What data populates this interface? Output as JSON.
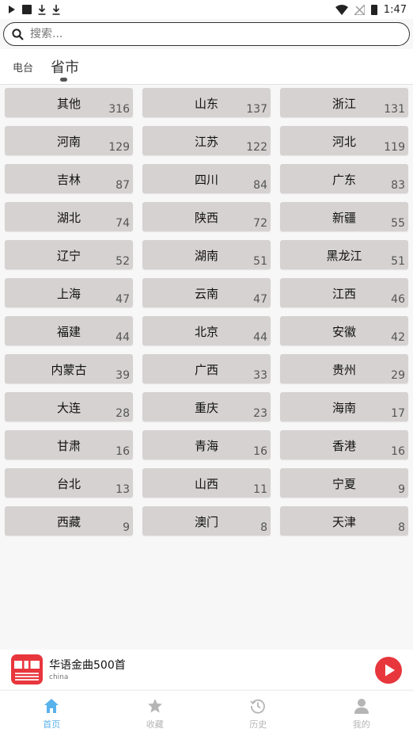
{
  "status_bar": {
    "time": "1:47"
  },
  "search": {
    "placeholder": "搜索..."
  },
  "tabs": [
    {
      "label": "电台",
      "active": false
    },
    {
      "label": "省市",
      "active": true
    }
  ],
  "provinces": [
    {
      "name": "其他",
      "count": "316"
    },
    {
      "name": "山东",
      "count": "137"
    },
    {
      "name": "浙江",
      "count": "131"
    },
    {
      "name": "河南",
      "count": "129"
    },
    {
      "name": "江苏",
      "count": "122"
    },
    {
      "name": "河北",
      "count": "119"
    },
    {
      "name": "吉林",
      "count": "87"
    },
    {
      "name": "四川",
      "count": "84"
    },
    {
      "name": "广东",
      "count": "83"
    },
    {
      "name": "湖北",
      "count": "74"
    },
    {
      "name": "陕西",
      "count": "72"
    },
    {
      "name": "新疆",
      "count": "55"
    },
    {
      "name": "辽宁",
      "count": "52"
    },
    {
      "name": "湖南",
      "count": "51"
    },
    {
      "name": "黑龙江",
      "count": "51"
    },
    {
      "name": "上海",
      "count": "47"
    },
    {
      "name": "云南",
      "count": "47"
    },
    {
      "name": "江西",
      "count": "46"
    },
    {
      "name": "福建",
      "count": "44"
    },
    {
      "name": "北京",
      "count": "44"
    },
    {
      "name": "安徽",
      "count": "42"
    },
    {
      "name": "内蒙古",
      "count": "39"
    },
    {
      "name": "广西",
      "count": "33"
    },
    {
      "name": "贵州",
      "count": "29"
    },
    {
      "name": "大连",
      "count": "28"
    },
    {
      "name": "重庆",
      "count": "23"
    },
    {
      "name": "海南",
      "count": "17"
    },
    {
      "name": "甘肃",
      "count": "16"
    },
    {
      "name": "青海",
      "count": "16"
    },
    {
      "name": "香港",
      "count": "16"
    },
    {
      "name": "台北",
      "count": "13"
    },
    {
      "name": "山西",
      "count": "11"
    },
    {
      "name": "宁夏",
      "count": "9"
    },
    {
      "name": "西藏",
      "count": "9"
    },
    {
      "name": "澳门",
      "count": "8"
    },
    {
      "name": "天津",
      "count": "8"
    }
  ],
  "player": {
    "title": "华语金曲500首",
    "subtitle": "china",
    "accent": "#e8363d"
  },
  "bottom_nav": [
    {
      "label": "首页",
      "icon": "home-icon",
      "active": true
    },
    {
      "label": "收藏",
      "icon": "star-icon",
      "active": false
    },
    {
      "label": "历史",
      "icon": "history-icon",
      "active": false
    },
    {
      "label": "我的",
      "icon": "user-icon",
      "active": false
    }
  ],
  "colors": {
    "active_nav": "#5ab2ec",
    "inactive_nav": "#b5b5b5",
    "cell_bg": "#d5d2d1"
  }
}
